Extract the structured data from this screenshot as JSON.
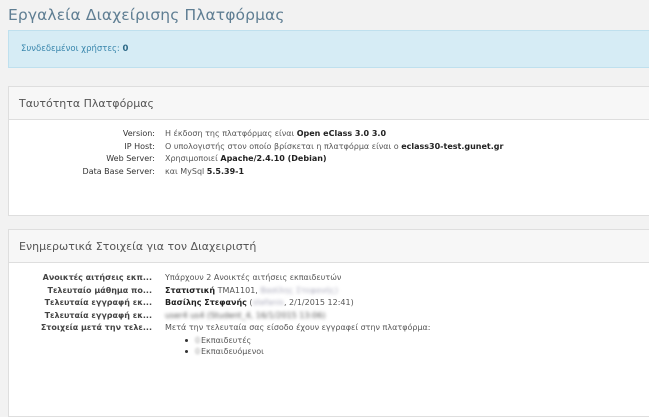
{
  "page_title": "Εργαλεία Διαχείρισης Πλατφόρμας",
  "alert": {
    "label": "Συνδεδεμένοι χρήστες:",
    "value": "0"
  },
  "identity": {
    "heading": "Ταυτότητα Πλατφόρμας",
    "rows": [
      {
        "key": "Version:",
        "text": "Η έκδοση της πλατφόρμας είναι ",
        "bold": "Open eClass 3.0 3.0",
        "tail": ""
      },
      {
        "key": "IP Host:",
        "text": "Ο υπολογιστής στον οποίο βρίσκεται η πλατφόρμα είναι ο ",
        "bold": "eclass30-test.gunet.gr",
        "tail": ""
      },
      {
        "key": "Web Server:",
        "text": "Χρησιμοποιεί ",
        "bold": "Apache/2.4.10 (Debian)",
        "tail": ""
      },
      {
        "key": "Data Base Server:",
        "text": "και MySql ",
        "bold": "5.5.39-1",
        "tail": ""
      }
    ]
  },
  "info": {
    "heading": "Ενημερωτικά Στοιχεία για τον Διαχειριστή",
    "rows": [
      {
        "key": "Ανοικτές αιτήσεις εκπ...",
        "text": "Υπάρχουν 2 Ανοικτές αιτήσεις εκπαιδευτών",
        "bold": "",
        "blur": ""
      },
      {
        "key": "Τελευταίο μάθημα πο...",
        "text": "",
        "bold": "Στατιστική",
        "tail": " TMA1101, ",
        "blur": "Βασίλης Στεφανής)"
      },
      {
        "key": "Τελευταία εγγραφή εκ...",
        "text": "",
        "bold": "Βασίλης Στεφανής",
        "tail": " (",
        "blur": "stefanis",
        "tail2": ", 2/1/2015 12:41)"
      },
      {
        "key": "Τελευταία εγγραφή εκ...",
        "text": "",
        "bold": "",
        "blur": "user4 us4 (Student_4, 16/1/2015 13:06)"
      },
      {
        "key": "Στοιχεία μετά την τελε...",
        "text": "Μετά την τελευταία σας είσοδο έχουν εγγραφεί στην πλατφόρμα:",
        "bold": "",
        "blur": ""
      }
    ],
    "bullets": [
      {
        "count": "0",
        "label": "Εκπαιδευτές"
      },
      {
        "count": "0",
        "label": "Εκπαιδευόμενοι"
      }
    ]
  }
}
